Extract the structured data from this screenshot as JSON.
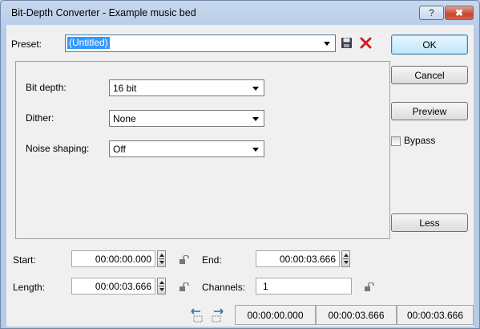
{
  "window": {
    "title": "Bit-Depth Converter - Example music bed",
    "help_label": "?",
    "close_label": "✖"
  },
  "preset": {
    "label": "Preset:",
    "value": "(Untitled)"
  },
  "buttons": {
    "ok": "OK",
    "cancel": "Cancel",
    "preview": "Preview",
    "bypass": "Bypass",
    "less": "Less"
  },
  "settings": {
    "bit_depth": {
      "label": "Bit depth:",
      "value": "16 bit"
    },
    "dither": {
      "label": "Dither:",
      "value": "None"
    },
    "noise_shaping": {
      "label": "Noise shaping:",
      "value": "Off"
    }
  },
  "range": {
    "start_label": "Start:",
    "start_value": "00:00:00.000",
    "end_label": "End:",
    "end_value": "00:00:03.666",
    "length_label": "Length:",
    "length_value": "00:00:03.666",
    "channels_label": "Channels:",
    "channels_value": "1"
  },
  "status": {
    "start": "00:00:00.000",
    "end": "00:00:03.666",
    "length": "00:00:03.666"
  },
  "colors": {
    "selection": "#3399ff",
    "delete_red": "#d02020"
  }
}
